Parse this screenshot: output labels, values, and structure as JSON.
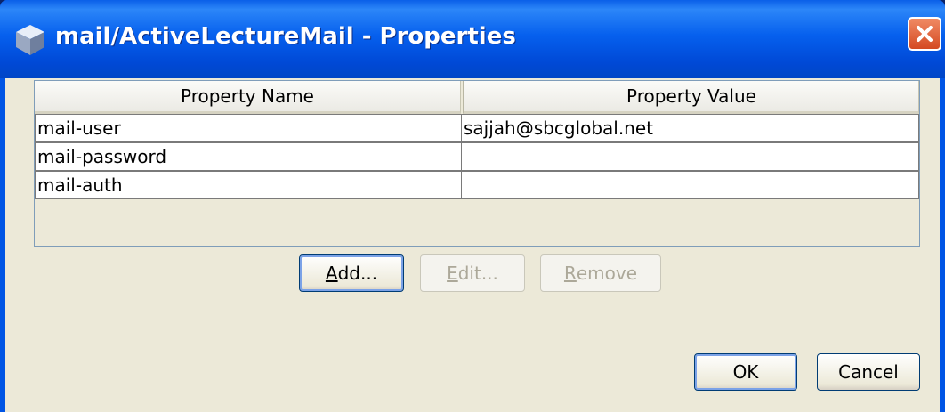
{
  "window": {
    "title": "mail/ActiveLectureMail - Properties",
    "title_icon": "cube-icon",
    "close_icon": "close-icon"
  },
  "table": {
    "columns": [
      "Property Name",
      "Property Value"
    ],
    "rows": [
      {
        "name": "mail-user",
        "value": "sajjah@sbcglobal.net"
      },
      {
        "name": "mail-password",
        "value": ""
      },
      {
        "name": "mail-auth",
        "value": ""
      }
    ]
  },
  "buttons": {
    "add": {
      "mnemonic": "A",
      "rest": "dd..."
    },
    "edit": {
      "mnemonic": "E",
      "rest": "dit..."
    },
    "remove": {
      "mnemonic": "R",
      "rest": "emove"
    },
    "ok": "OK",
    "cancel": "Cancel"
  },
  "colors": {
    "titlebar": "#0055e5",
    "client_bg": "#ece9d8",
    "close_button": "#e0532c"
  }
}
